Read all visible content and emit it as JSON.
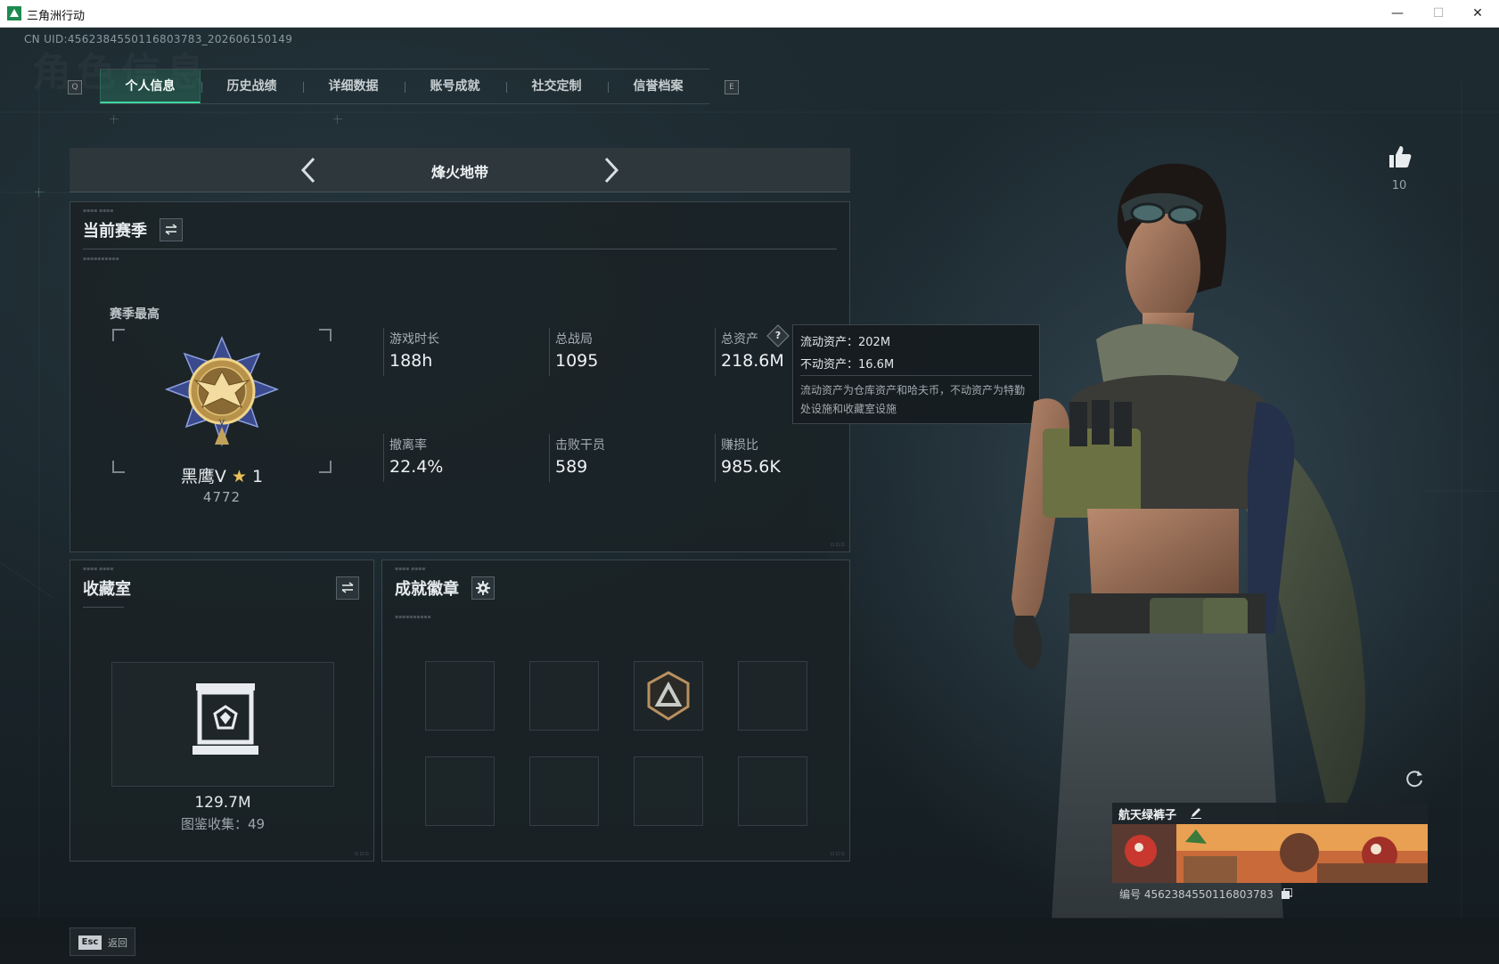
{
  "window": {
    "title": "三角洲行动",
    "min": "—",
    "max": "☐",
    "close": "✕"
  },
  "uid_line": "CN UID:456238455011680378​3_202606150149",
  "watermark": "角色信息",
  "tabs": {
    "prev_key": "Q",
    "next_key": "E",
    "items": [
      {
        "label": "个人信息",
        "active": true
      },
      {
        "label": "历史战绩",
        "active": false
      },
      {
        "label": "详细数据",
        "active": false
      },
      {
        "label": "账号成就",
        "active": false
      },
      {
        "label": "社交定制",
        "active": false
      },
      {
        "label": "信誉档案",
        "active": false
      }
    ]
  },
  "mode": {
    "title": "烽火地带"
  },
  "season": {
    "title": "当前赛季",
    "best_label": "赛季最高",
    "rank_name": "黑鹰V",
    "rank_star": "★",
    "rank_stars": "1",
    "rank_score": "4772",
    "stats": [
      {
        "label": "游戏时长",
        "value": "188h"
      },
      {
        "label": "总战局",
        "value": "1095"
      },
      {
        "label": "总资产",
        "value": "218.6M"
      },
      {
        "label": "撤离率",
        "value": "22.4%"
      },
      {
        "label": "击败干员",
        "value": "589"
      },
      {
        "label": "赚损比",
        "value": "985.6K"
      }
    ],
    "help": "?"
  },
  "tooltip": {
    "liquid": "流动资产：202M",
    "fixed": "不动资产：16.6M",
    "desc": "流动资产为仓库资产和哈夫币，不动资产为特勤处设施和收藏室设施"
  },
  "collection": {
    "title": "收藏室",
    "value": "129.7M",
    "count_text": "图鉴收集：49"
  },
  "badges": {
    "title": "成就徽章"
  },
  "like": {
    "count": "10"
  },
  "name_card": {
    "name": "航天绿裤子",
    "id_text": "编号 4562384550116803783"
  },
  "footer": {
    "esc_key": "Esc",
    "back_label": "返回"
  },
  "colors": {
    "accent": "#3fd5a0",
    "gold": "#e9c25a",
    "panel": "#1a2226"
  }
}
